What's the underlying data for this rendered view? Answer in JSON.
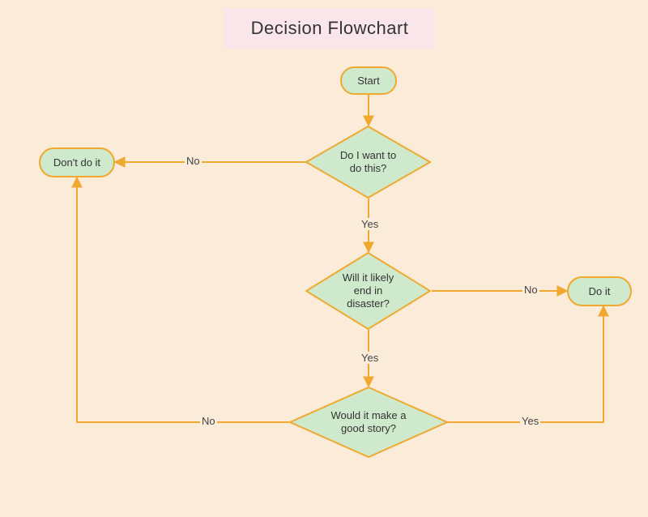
{
  "title": "Decision Flowchart",
  "nodes": {
    "start": {
      "label": "Start"
    },
    "dont": {
      "label": "Don't do it"
    },
    "doit": {
      "label": "Do it"
    },
    "q_want": {
      "label": "Do I want to\ndo this?"
    },
    "q_disaster": {
      "label": "Will it likely\nend in\ndisaster?"
    },
    "q_story": {
      "label": "Would it make a\ngood story?"
    }
  },
  "edges": {
    "want_no": "No",
    "want_yes": "Yes",
    "disaster_no": "No",
    "disaster_yes": "Yes",
    "story_no": "No",
    "story_yes": "Yes"
  },
  "colors": {
    "background": "#faecd9",
    "titleBg": "#fae6ea",
    "nodeFill": "#cee9cc",
    "stroke": "#f0a92e"
  }
}
